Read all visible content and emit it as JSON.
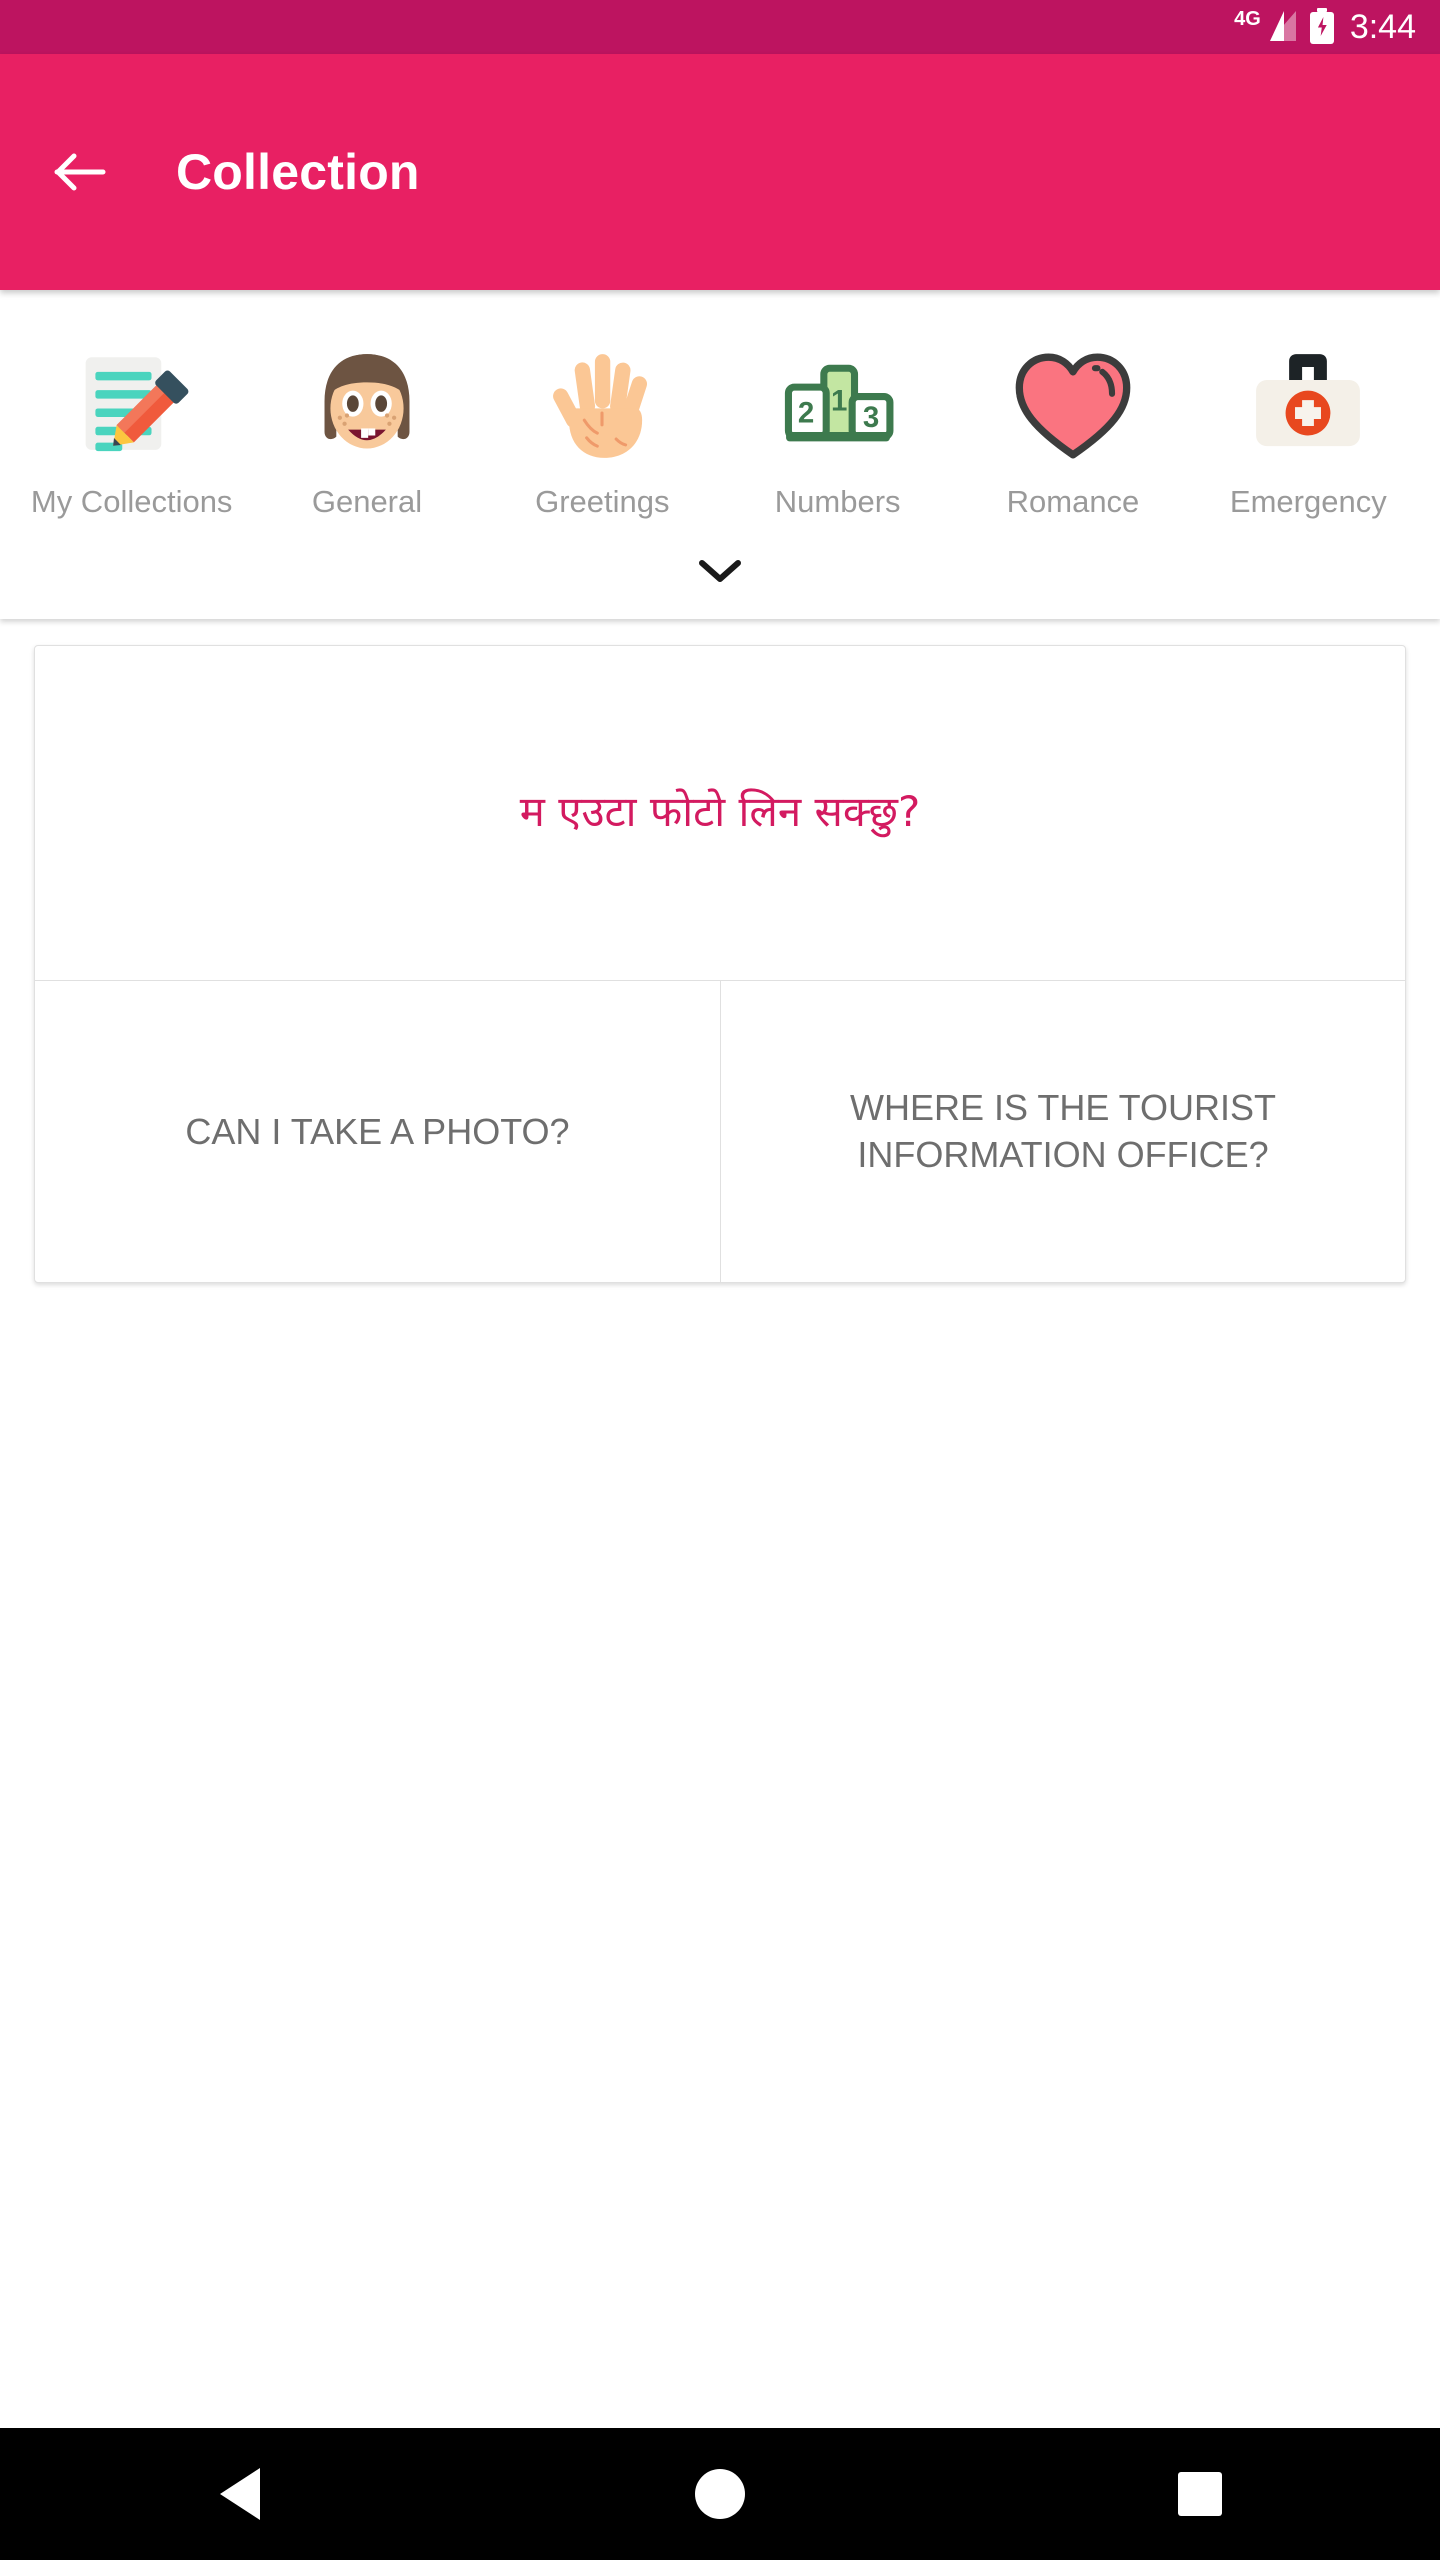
{
  "status_bar": {
    "network_label": "4G",
    "time": "3:44",
    "signal_icon": "signal-bars-icon",
    "battery_icon": "battery-charging-icon",
    "background_color": "#BD1460"
  },
  "app_bar": {
    "back_icon": "back-arrow-icon",
    "title": "Collection",
    "background_color": "#E82063",
    "text_color": "#FFFFFF"
  },
  "categories": {
    "expand_icon": "chevron-down-icon",
    "label_color": "#9A9A9A",
    "items": [
      {
        "label": "My Collections",
        "icon": "note-pencil-icon"
      },
      {
        "label": "General",
        "icon": "face-smiling-icon"
      },
      {
        "label": "Greetings",
        "icon": "raised-hand-icon"
      },
      {
        "label": "Numbers",
        "icon": "podium-123-icon"
      },
      {
        "label": "Romance",
        "icon": "heart-icon"
      },
      {
        "label": "Emergency",
        "icon": "first-aid-kit-icon"
      }
    ]
  },
  "phrase_card": {
    "native_text": "म एउटा फोटो लिन सक्छु?",
    "native_text_color": "#D31A60",
    "translations": [
      "CAN I TAKE A PHOTO?",
      "WHERE IS THE TOURIST INFORMATION OFFICE?"
    ],
    "translation_color": "#6E6E6E"
  },
  "nav_bar": {
    "background_color": "#000000",
    "buttons": [
      {
        "name": "back-triangle-icon"
      },
      {
        "name": "home-circle-icon"
      },
      {
        "name": "recents-square-icon"
      }
    ]
  }
}
